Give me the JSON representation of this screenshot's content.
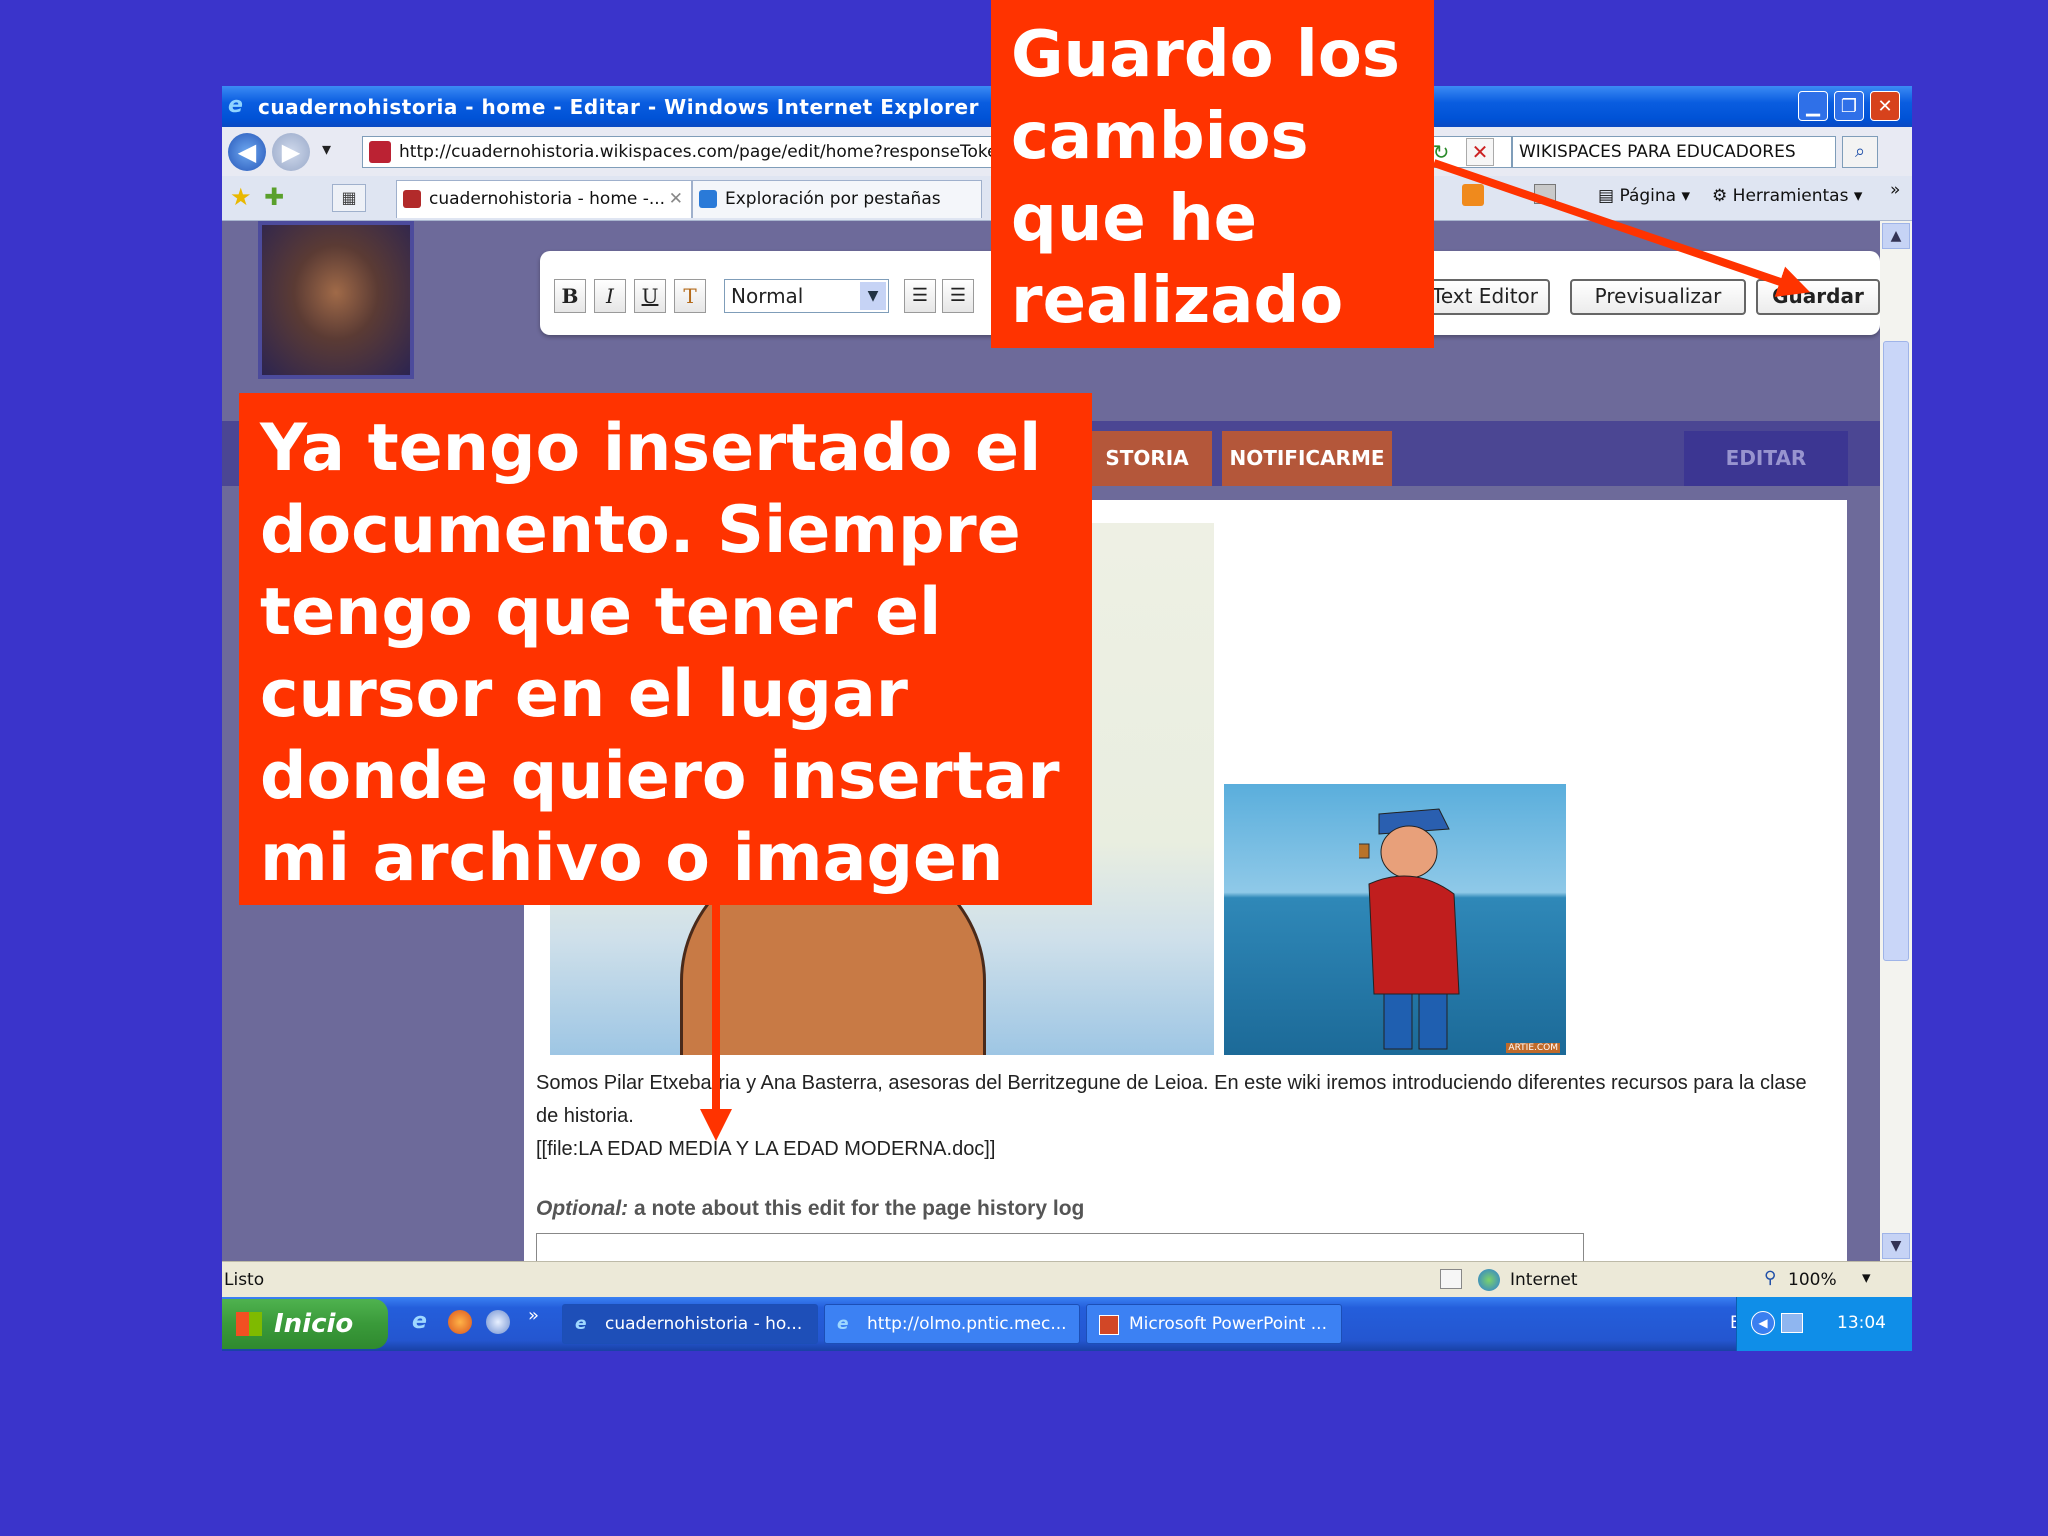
{
  "window": {
    "title": "cuadernohistoria - home - Editar - Windows Internet Explorer",
    "min": "▁",
    "max": "❐",
    "close": "✕"
  },
  "address_bar": {
    "back": "◀",
    "forward": "▶",
    "dropdown": "▾",
    "url": "http://cuadernohistoria.wikispaces.com/page/edit/home?responseToken=c",
    "refresh": "↻",
    "stop": "✕",
    "search_value": "WIKISPACES PARA EDUCADORES",
    "search_go": "⌕"
  },
  "tabs": [
    {
      "label": "cuadernohistoria - home -...",
      "close": "✕",
      "icon_color": "#b22a2a"
    },
    {
      "label": "Exploración por pestañas",
      "icon_color": "#2a7ad8"
    }
  ],
  "command_bar": {
    "pagina": "Página",
    "herramientas": "Herramientas",
    "more": "»"
  },
  "editor_toolbar": {
    "bold": "B",
    "italic": "I",
    "underline": "U",
    "format": "Normal",
    "text_editor": "Text Editor",
    "preview": "Previsualizar",
    "save": "Guardar"
  },
  "site_nav": {
    "historia": "STORIA",
    "notificarme": "NOTIFICARME",
    "editar": "EDITAR"
  },
  "page": {
    "paragraph": "Somos Pilar Etxebarria y Ana Basterra, asesoras del Berritzegune de Leioa. En este wiki iremos introduciendo diferentes recursos para la clase de historia.",
    "file_tag": "[[file:LA EDAD MEDIA Y LA EDAD MODERNA.doc]]",
    "optional_label": "Optional:",
    "optional_text": "a note about this edit for the page history log",
    "image_credit": "ARTIE.COM"
  },
  "status_bar": {
    "status": "Listo",
    "zone": "Internet",
    "zoom": "100%"
  },
  "taskbar": {
    "start": "Inicio",
    "tasks": [
      "cuadernohistoria - ho...",
      "http://olmo.pntic.mec...",
      "Microsoft PowerPoint ..."
    ],
    "lang": "ES",
    "clock": "13:04"
  },
  "callouts": {
    "top": "Guardo los cambios que he realizado",
    "left": "Ya tengo insertado el documento. Siempre tengo que tener el cursor en el lugar donde quiero insertar mi archivo o imagen"
  },
  "colors": {
    "background": "#3a34cb",
    "callout": "#ff3300",
    "site_tab": "#b4573a",
    "site_band": "#4b4693"
  }
}
